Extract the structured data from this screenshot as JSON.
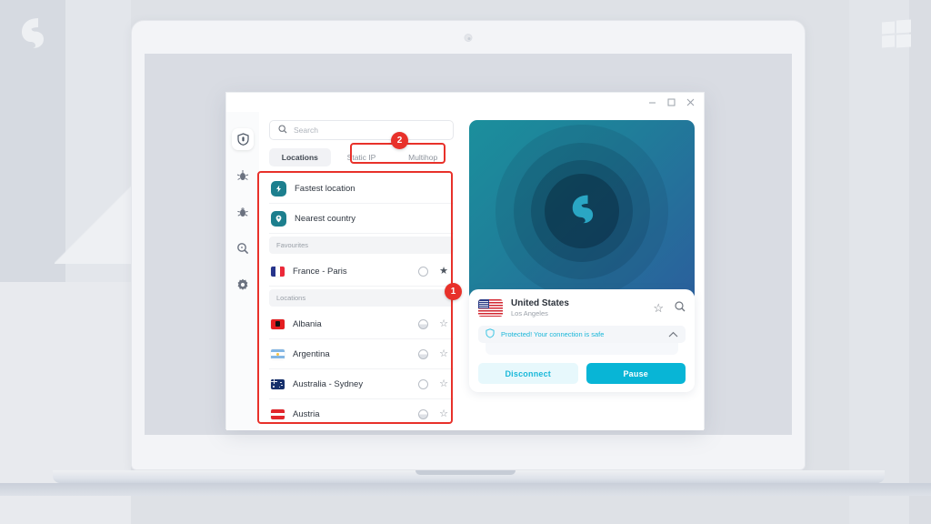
{
  "branding": {
    "logo_icon": "surfshark-fin-logo",
    "os_icon": "windows-logo"
  },
  "window": {
    "controls": [
      {
        "name": "minimize",
        "icon": "minimize-icon"
      },
      {
        "name": "maximize",
        "icon": "maximize-icon"
      },
      {
        "name": "close",
        "icon": "close-icon"
      }
    ]
  },
  "rail": {
    "items": [
      {
        "name": "vpn",
        "icon": "shield-icon",
        "active": true
      },
      {
        "name": "alternative-id",
        "icon": "bug-alert-icon",
        "active": false
      },
      {
        "name": "antivirus",
        "icon": "bug-icon",
        "active": false
      },
      {
        "name": "alert-search",
        "icon": "magnifier-icon",
        "active": false
      },
      {
        "name": "settings",
        "icon": "gear-icon",
        "active": false
      }
    ]
  },
  "search": {
    "placeholder": "Search",
    "icon": "search-icon"
  },
  "tabs": [
    {
      "label": "Locations",
      "active": true
    },
    {
      "label": "Static IP",
      "active": false
    },
    {
      "label": "Multihop",
      "active": false
    }
  ],
  "quick_connect": [
    {
      "label": "Fastest location",
      "icon": "lightning-icon"
    },
    {
      "label": "Nearest country",
      "icon": "pin-icon"
    }
  ],
  "sections": [
    {
      "title": "Favourites",
      "rows": [
        {
          "label": "France - Paris",
          "flag": "fr",
          "ping_icon": "ping-circle",
          "star_icon": "star-filled-icon",
          "favourite": true
        }
      ]
    },
    {
      "title": "Locations",
      "rows": [
        {
          "label": "Albania",
          "flag": "al",
          "ping_icon": "ping-circle",
          "star_icon": "star-outline-icon",
          "favourite": false
        },
        {
          "label": "Argentina",
          "flag": "ar",
          "ping_icon": "ping-circle",
          "star_icon": "star-outline-icon",
          "favourite": false
        },
        {
          "label": "Australia - Sydney",
          "flag": "au",
          "ping_icon": "ping-circle",
          "star_icon": "star-outline-icon",
          "favourite": false
        },
        {
          "label": "Austria",
          "flag": "at",
          "ping_icon": "ping-circle",
          "star_icon": "star-outline-icon",
          "favourite": false
        }
      ]
    }
  ],
  "connection": {
    "hero_logo": "surfshark-fin-logo",
    "country": "United States",
    "city": "Los Angeles",
    "favourite_icon": "star-outline-icon",
    "search_icon": "search-icon",
    "status_icon": "shield-icon",
    "status_text": "Protected! Your connection is safe",
    "collapse_icon": "chevron-up-icon",
    "buttons": {
      "secondary": "Disconnect",
      "primary": "Pause"
    }
  },
  "annotations": [
    {
      "badge": "1",
      "target": "locations-list"
    },
    {
      "badge": "2",
      "target": "static-ip-multihop-tabs"
    }
  ],
  "colors": {
    "accent_teal": "#08b5d6",
    "quick_icon_teal": "#1d7f8e",
    "annotation_red": "#e8312a",
    "status_text": "#18b6d8"
  }
}
